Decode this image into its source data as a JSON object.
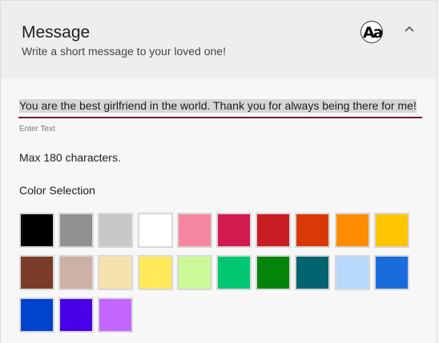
{
  "header": {
    "title": "Message",
    "subtitle": "Write a short message to your loved one!",
    "font_icon_text": "Aa",
    "font_icon": "font-style-icon",
    "collapse_icon": "chevron-up-icon"
  },
  "message": {
    "value": "You are the best girlfriend in the world. Thank you for always being there for me!",
    "hint": "Enter Text",
    "max_note": "Max 180 characters."
  },
  "colors": {
    "label": "Color Selection",
    "swatches": [
      "#000000",
      "#919191",
      "#c8c8c8",
      "#ffffff",
      "#f4879f",
      "#d11b51",
      "#c91d24",
      "#d93a05",
      "#ff8b00",
      "#ffc500",
      "#7a3b28",
      "#cdb0a6",
      "#f5e2ad",
      "#ffea5a",
      "#cdfa98",
      "#03c873",
      "#05840c",
      "#03636e",
      "#b7dafc",
      "#1a6cdd",
      "#0044ce",
      "#4a00e6",
      "#c266ff"
    ]
  },
  "accent": "#6a1840"
}
